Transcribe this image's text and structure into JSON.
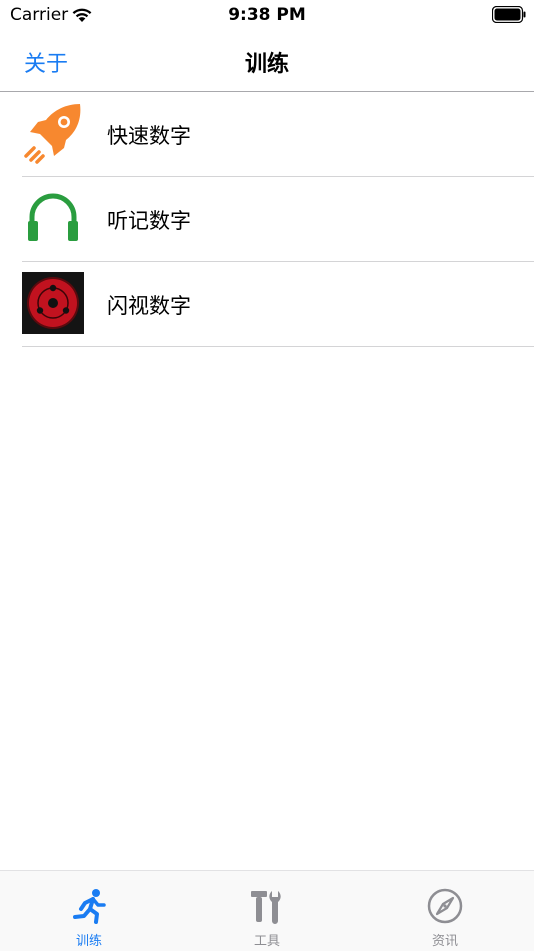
{
  "status_bar": {
    "carrier": "Carrier",
    "time": "9:38 PM"
  },
  "nav": {
    "left_label": "关于",
    "title": "训练"
  },
  "list": {
    "items": [
      {
        "label": "快速数字",
        "icon": "rocket-icon"
      },
      {
        "label": "听记数字",
        "icon": "headphones-icon"
      },
      {
        "label": "闪视数字",
        "icon": "sharingan-eye-icon"
      }
    ]
  },
  "tabs": [
    {
      "label": "训练",
      "icon": "running-person-icon",
      "active": true
    },
    {
      "label": "工具",
      "icon": "tools-icon",
      "active": false
    },
    {
      "label": "资讯",
      "icon": "compass-icon",
      "active": false
    }
  ],
  "colors": {
    "accent": "#1a7cf2",
    "inactive": "#8e8e93",
    "rocket": "#f7882f",
    "headphones": "#2a9d3f",
    "eye_red": "#c1121f"
  }
}
